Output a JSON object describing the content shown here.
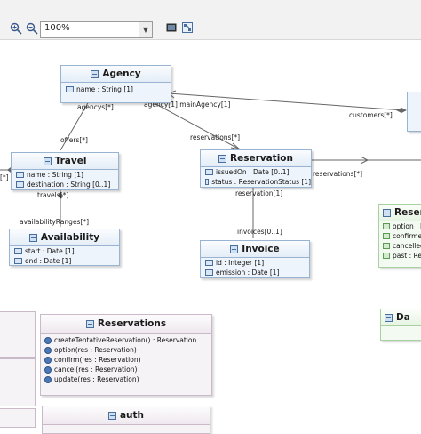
{
  "toolbar": {
    "zoom_in_icon": "zoom-in-icon",
    "zoom_out_icon": "zoom-out-icon",
    "zoom_value": "100%",
    "export_icon": "export-image-icon",
    "layout_icon": "layout-icon"
  },
  "diagram": {
    "classes": {
      "agency": {
        "name": "Agency",
        "attrs": [
          "name : String [1]"
        ]
      },
      "travel": {
        "name": "Travel",
        "attrs": [
          "name : String [1]",
          "destination : String [0..1]"
        ]
      },
      "reservation": {
        "name": "Reservation",
        "attrs": [
          "issuedOn : Date [0..1]",
          "status : ReservationStatus [1]"
        ]
      },
      "availability": {
        "name": "Availability",
        "attrs": [
          "start : Date [1]",
          "end : Date [1]"
        ]
      },
      "invoice": {
        "name": "Invoice",
        "attrs": [
          "id : Integer [1]",
          "emission : Date [1]"
        ]
      },
      "date_partial": {
        "name": "Da"
      }
    },
    "enum_status": {
      "name": "Reser",
      "literals": [
        "option : Re",
        "confirmed",
        "cancelled",
        "past : Res"
      ]
    },
    "interfaces": {
      "reservations": {
        "name": "Reservations",
        "ops": [
          "createTentativeReservation() : Reservation",
          "option(res : Reservation)",
          "confirm(res : Reservation)",
          "cancel(res : Reservation)",
          "update(res : Reservation)"
        ]
      },
      "auth": {
        "name": "auth"
      }
    },
    "edge_labels": {
      "agencys": "agencys[*]",
      "offers": "offers[*]",
      "agency_main": "agency[1] mainAgency[1]",
      "reservations_agency": "reservations[*]",
      "customers": "customers[*]",
      "travels": "travels[*]",
      "availability_ranges": "availabilityRanges[*]",
      "reservation_invoice": "reservation[1]",
      "invoices": "invoices[0..1]",
      "reservations_right": "reservations[*]",
      "left_stub": "[*]"
    }
  }
}
